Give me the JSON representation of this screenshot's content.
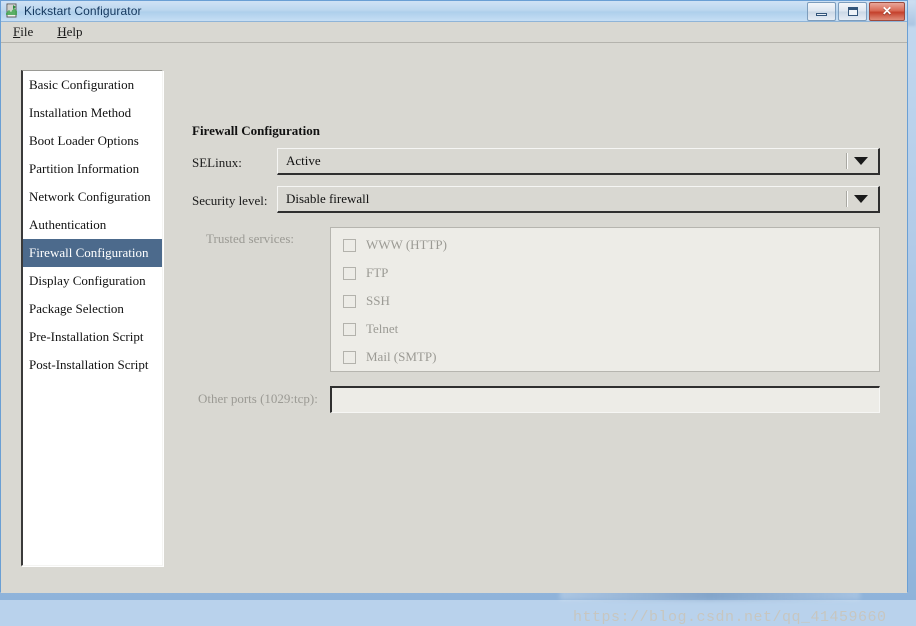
{
  "window": {
    "title": "Kickstart Configurator",
    "icon": "app-icon",
    "controls": {
      "minimize": "–",
      "maximize": "□",
      "close": "✕"
    }
  },
  "menubar": {
    "items": [
      {
        "label": "File",
        "mnemonic": "F"
      },
      {
        "label": "Help",
        "mnemonic": "H"
      }
    ]
  },
  "sidebar": {
    "items": [
      {
        "label": "Basic Configuration",
        "selected": false
      },
      {
        "label": "Installation Method",
        "selected": false
      },
      {
        "label": "Boot Loader Options",
        "selected": false
      },
      {
        "label": "Partition Information",
        "selected": false
      },
      {
        "label": "Network Configuration",
        "selected": false
      },
      {
        "label": "Authentication",
        "selected": false
      },
      {
        "label": "Firewall Configuration",
        "selected": true
      },
      {
        "label": "Display Configuration",
        "selected": false
      },
      {
        "label": "Package Selection",
        "selected": false
      },
      {
        "label": "Pre-Installation Script",
        "selected": false
      },
      {
        "label": "Post-Installation Script",
        "selected": false
      }
    ]
  },
  "main": {
    "title": "Firewall Configuration",
    "selinux": {
      "label": "SELinux:",
      "value": "Active"
    },
    "security_level": {
      "label": "Security level:",
      "value": "Disable firewall"
    },
    "trusted_services": {
      "label": "Trusted services:",
      "disabled": true,
      "items": [
        {
          "label": "WWW (HTTP)",
          "checked": false
        },
        {
          "label": "FTP",
          "checked": false
        },
        {
          "label": "SSH",
          "checked": false
        },
        {
          "label": "Telnet",
          "checked": false
        },
        {
          "label": "Mail (SMTP)",
          "checked": false
        }
      ]
    },
    "other_ports": {
      "label": "Other ports (1029:tcp):",
      "value": "",
      "disabled": true
    }
  },
  "watermark": {
    "text": "https://blog.csdn.net/qq_41459660"
  },
  "colors": {
    "selection": "#4c6a8c",
    "window_bg": "#d9d8d2",
    "field_bg": "#edece7",
    "title_text": "#13365c",
    "disabled_text": "#9b9a94",
    "close_button": "#c4412c"
  }
}
